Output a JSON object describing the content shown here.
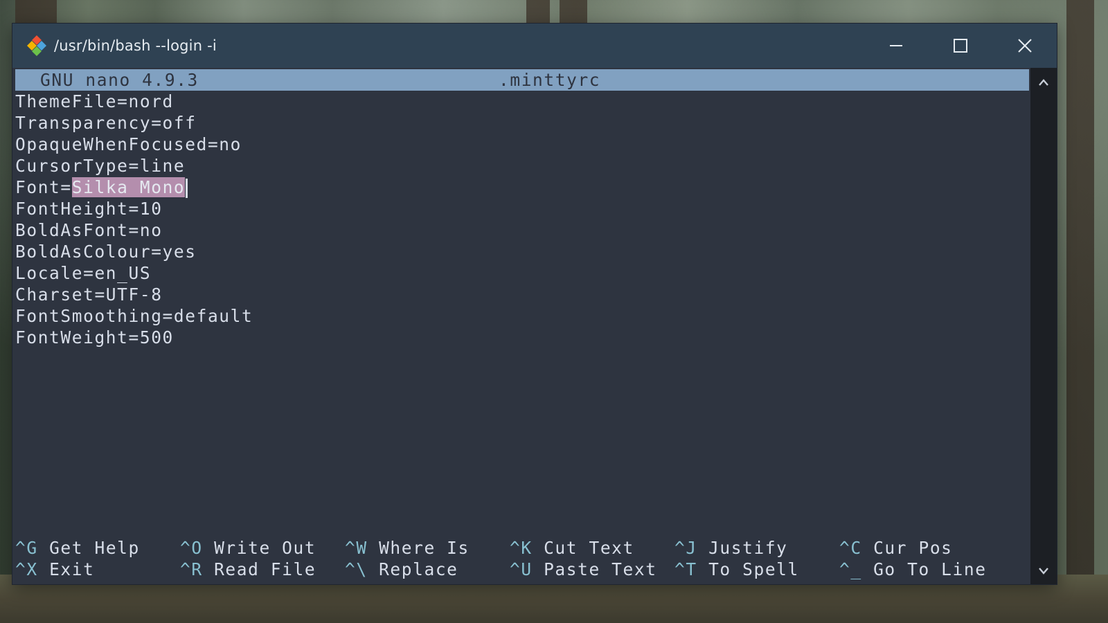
{
  "window": {
    "title": "/usr/bin/bash --login -i",
    "icon": "git-bash-icon",
    "controls": [
      "minimize-icon",
      "maximize-icon",
      "close-icon"
    ]
  },
  "colors": {
    "terminal_bg": "#2e3440",
    "header_bg": "#81a1c1",
    "selection_bg": "#b48ead",
    "text": "#d8dee9",
    "shortcut_key": "#88c0d0",
    "titlebar_bg": "#2f4253"
  },
  "nano": {
    "version": "GNU nano 4.9.3",
    "filename": ".minttyrc",
    "lines": [
      {
        "text": "ThemeFile=nord"
      },
      {
        "text": "Transparency=off"
      },
      {
        "text": "OpaqueWhenFocused=no"
      },
      {
        "text": "CursorType=line"
      },
      {
        "prefix": "Font=",
        "selected": "Silka Mono"
      },
      {
        "text": "FontHeight=10"
      },
      {
        "text": "BoldAsFont=no"
      },
      {
        "text": "BoldAsColour=yes"
      },
      {
        "text": "Locale=en_US"
      },
      {
        "text": "Charset=UTF-8"
      },
      {
        "text": "FontSmoothing=default"
      },
      {
        "text": "FontWeight=500"
      }
    ],
    "shortcuts": [
      [
        {
          "key": "^G",
          "label": "Get Help"
        },
        {
          "key": "^O",
          "label": "Write Out"
        },
        {
          "key": "^W",
          "label": "Where Is"
        },
        {
          "key": "^K",
          "label": "Cut Text"
        },
        {
          "key": "^J",
          "label": "Justify"
        },
        {
          "key": "^C",
          "label": "Cur Pos"
        }
      ],
      [
        {
          "key": "^X",
          "label": "Exit"
        },
        {
          "key": "^R",
          "label": "Read File"
        },
        {
          "key": "^\\",
          "label": "Replace"
        },
        {
          "key": "^U",
          "label": "Paste Text"
        },
        {
          "key": "^T",
          "label": "To Spell"
        },
        {
          "key": "^_",
          "label": "Go To Line"
        }
      ]
    ]
  }
}
